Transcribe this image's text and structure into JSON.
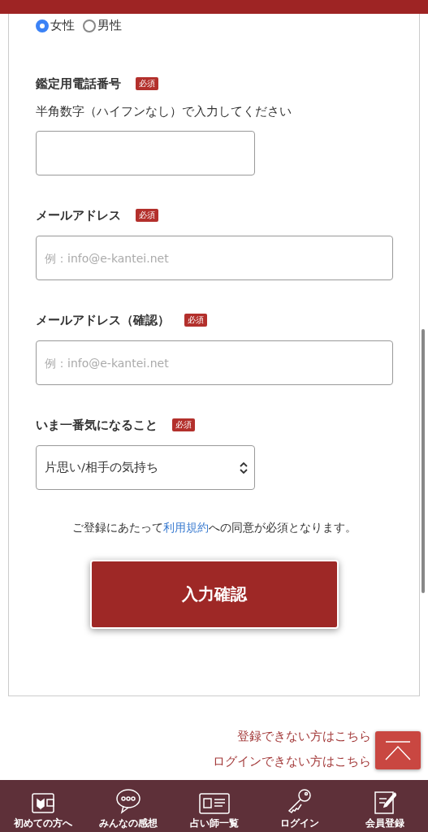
{
  "gender": [
    {
      "label": "女性",
      "selected": true
    },
    {
      "label": "男性",
      "selected": false
    }
  ],
  "fields": [
    {
      "kind": "phone",
      "label": "鑑定用電話番号",
      "badge": "必須",
      "hint": "半角数字（ハイフンなし）で入力してください"
    },
    {
      "kind": "email",
      "label": "メールアドレス",
      "badge": "必須",
      "placeholder": "例：info@e-kantei.net"
    },
    {
      "kind": "email",
      "label": "メールアドレス（確認）",
      "badge": "必須",
      "placeholder": "例：info@e-kantei.net"
    },
    {
      "kind": "select",
      "label": "いま一番気になること",
      "badge": "必須",
      "value": "片思い/相手の気持ち"
    }
  ],
  "consent": {
    "before": "ご登録にあたって",
    "link": "利用規約",
    "after": "への同意が必須となります。"
  },
  "submit": "入力確認",
  "links": [
    "登録できない方はこちら",
    "ログインできない方はこちら"
  ],
  "nav": [
    {
      "kind": "beginner",
      "label": "初めての方へ"
    },
    {
      "kind": "chat",
      "label": "みんなの感想"
    },
    {
      "kind": "card",
      "label": "占い師一覧"
    },
    {
      "kind": "key",
      "label": "ログイン"
    },
    {
      "kind": "note",
      "label": "会員登録"
    }
  ]
}
